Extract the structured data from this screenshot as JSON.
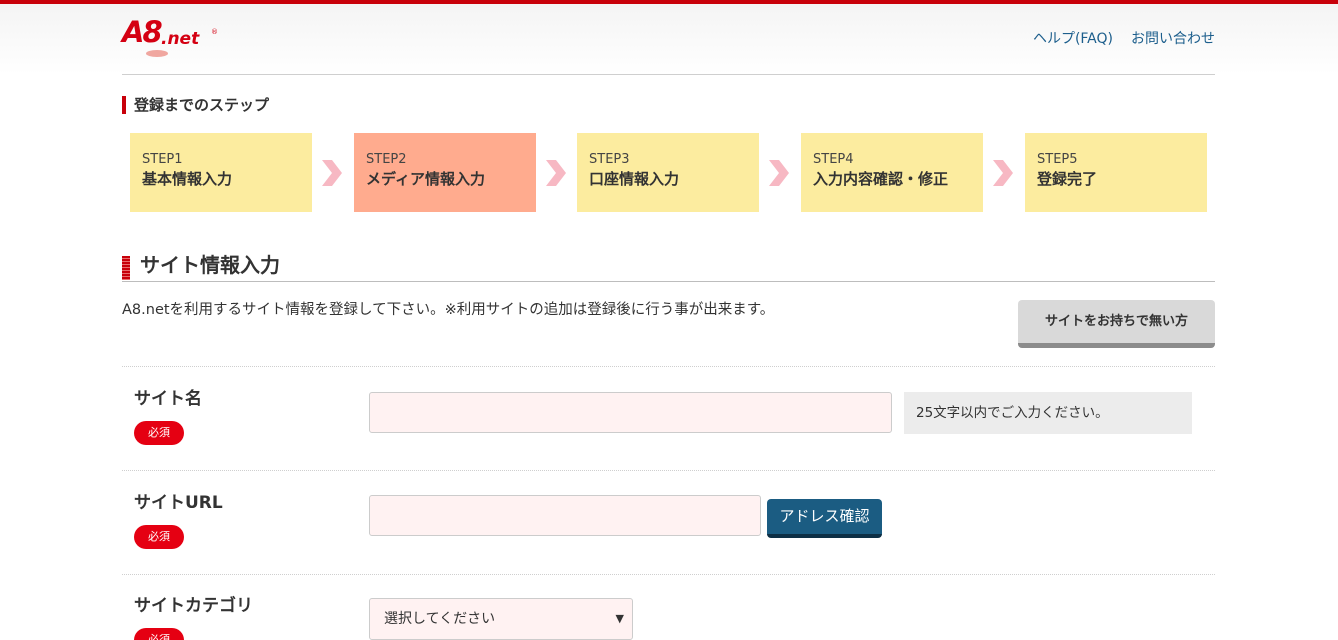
{
  "header": {
    "logo_main": "A8",
    "logo_sub": ".net",
    "logo_reg": "®",
    "links": [
      "ヘルプ(FAQ)",
      "お問い合わせ"
    ]
  },
  "steps": {
    "title": "登録までのステップ",
    "items": [
      {
        "num": "STEP1",
        "label": "基本情報入力",
        "active": false
      },
      {
        "num": "STEP2",
        "label": "メディア情報入力",
        "active": true
      },
      {
        "num": "STEP3",
        "label": "口座情報入力",
        "active": false
      },
      {
        "num": "STEP4",
        "label": "入力内容確認・修正",
        "active": false
      },
      {
        "num": "STEP5",
        "label": "登録完了",
        "active": false
      }
    ],
    "colors": {
      "normal": "#fcec9f",
      "active": "#ffab8e",
      "chevron": "#f7b8c3"
    }
  },
  "section": {
    "title": "サイト情報入力",
    "intro": "A8.netを利用するサイト情報を登録して下さい。※利用サイトの追加は登録後に行う事が出来ます。",
    "no_site_button": "サイトをお持ちで無い方"
  },
  "form": {
    "required_label": "必須",
    "site_name": {
      "label": "サイト名",
      "value": "",
      "hint": "25文字以内でご入力ください。"
    },
    "site_url": {
      "label": "サイトURL",
      "value": "",
      "button": "アドレス確認"
    },
    "site_category": {
      "label": "サイトカテゴリ",
      "selected": "選択してください"
    }
  },
  "colors": {
    "brand_red": "#c8000a",
    "link_blue": "#1c5e8c",
    "button_navy": "#1b5c82",
    "input_bg": "#fff2f2"
  }
}
